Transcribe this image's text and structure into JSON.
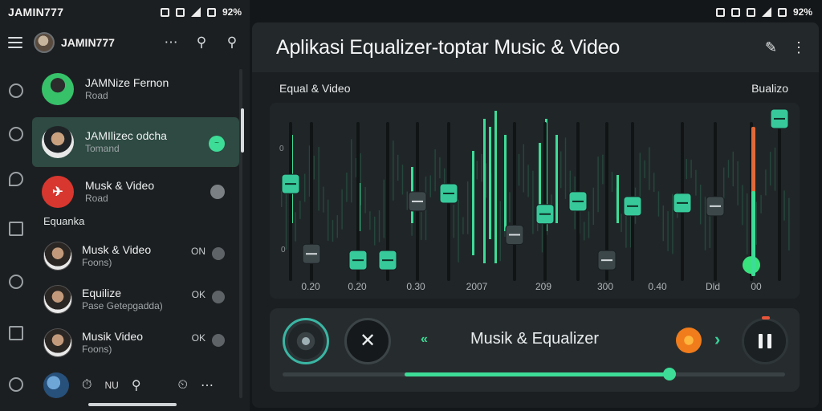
{
  "status": {
    "left_title": "JAMIN777",
    "left_battery": "92%",
    "right_battery": "92%"
  },
  "sidebar": {
    "title": "JAMIN777",
    "chats": [
      {
        "name": "JAMNize Fernon",
        "sub": "Road"
      },
      {
        "name": "JAMIlizec odcha",
        "sub": "Tomand"
      },
      {
        "name": "Musk & Video",
        "sub": "Road"
      }
    ],
    "section_label": "Equanka",
    "items": [
      {
        "name": "Musk & Video",
        "sub": "Foons)",
        "count": "ON"
      },
      {
        "name": "Equilize",
        "sub": "Pase Getepgadda)",
        "count": "OK"
      },
      {
        "name": "Musik Video",
        "sub": "Foons)",
        "count": "OK"
      }
    ],
    "bottom_label": "NU"
  },
  "header": {
    "title": "Aplikasi Equalizer-toptar Music & Video"
  },
  "equalizer": {
    "label_left": "Equal & Video",
    "label_right": "Bualizo",
    "freq_labels": [
      "0.20",
      "0.20",
      "0.30",
      "2007",
      "209",
      "300",
      "0.40",
      "Dld",
      "00"
    ],
    "axis_marks": [
      "0",
      "0"
    ],
    "band_levels": [
      0.56,
      0.12,
      0.08,
      0.08,
      0.45,
      0.5,
      0.24,
      0.37,
      0.45,
      0.08,
      0.42,
      0.44,
      0.42,
      0.05,
      0.97
    ]
  },
  "player": {
    "track_title": "Musik & Equalizer",
    "progress": 0.63
  },
  "colors": {
    "accent": "#3ddc97",
    "accent_dark": "#2bb07a",
    "panel": "#202628",
    "orange": "#f07c1b"
  }
}
